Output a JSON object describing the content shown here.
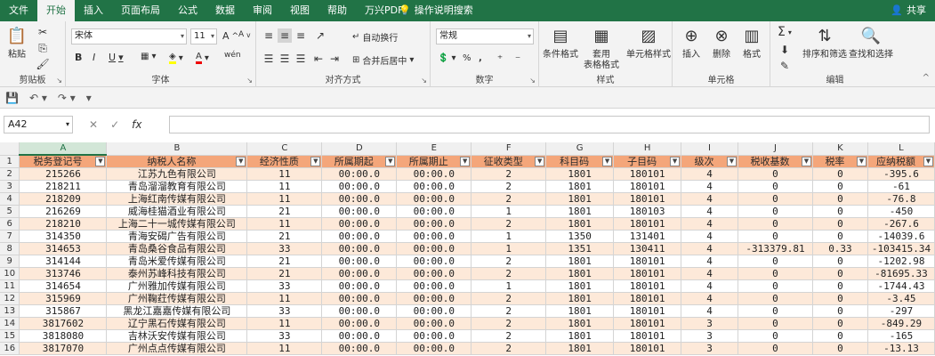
{
  "menu": {
    "tabs": [
      "文件",
      "开始",
      "插入",
      "页面布局",
      "公式",
      "数据",
      "审阅",
      "视图",
      "帮助",
      "万兴PDF"
    ],
    "active": "开始",
    "tellme": "操作说明搜索",
    "share": "共享"
  },
  "ribbon": {
    "clipboard": {
      "paste": "粘贴",
      "label": "剪贴板"
    },
    "font": {
      "name": "宋体",
      "size": "11",
      "bold": "B",
      "italic": "I",
      "underline": "U",
      "grow": "A",
      "shrink": "A",
      "fill_letter": "",
      "color_letter": "A",
      "wen": "wén",
      "label": "字体"
    },
    "align": {
      "wrap": "自动换行",
      "merge": "合并后居中",
      "label": "对齐方式"
    },
    "number": {
      "format": "常规",
      "percent": "%",
      "comma": ",",
      "label": "数字"
    },
    "styles": {
      "cond": "条件格式",
      "table1": "套用",
      "table2": "表格格式",
      "cell": "单元格样式",
      "label": "样式"
    },
    "cells": {
      "insert": "插入",
      "delete": "删除",
      "format": "格式",
      "label": "单元格"
    },
    "editing": {
      "sum": "Σ",
      "sort": "排序和筛选",
      "find": "查找和选择",
      "label": "编辑"
    }
  },
  "formula_bar": {
    "namebox": "A42",
    "fx": "fx",
    "value": ""
  },
  "sheet": {
    "columns": [
      "A",
      "B",
      "C",
      "D",
      "E",
      "F",
      "G",
      "H",
      "I",
      "J",
      "K",
      "L"
    ],
    "selected_column": "A",
    "selected_cell": "A42",
    "headers": [
      "税务登记号",
      "纳税人名称",
      "经济性质",
      "所属期起",
      "所属期止",
      "征收类型",
      "科目码",
      "子目码",
      "级次",
      "税收基数",
      "税率",
      "应纳税额"
    ],
    "rows": [
      {
        "n": "2",
        "c": [
          "215266",
          "江苏九色有限公司",
          "11",
          "00:00.0",
          "00:00.0",
          "2",
          "1801",
          "180101",
          "4",
          "0",
          "0",
          "-395.6"
        ]
      },
      {
        "n": "3",
        "c": [
          "218211",
          "青岛溜溜教育有限公司",
          "11",
          "00:00.0",
          "00:00.0",
          "2",
          "1801",
          "180101",
          "4",
          "0",
          "0",
          "-61"
        ]
      },
      {
        "n": "4",
        "c": [
          "218209",
          "上海红南传媒有限公司",
          "11",
          "00:00.0",
          "00:00.0",
          "2",
          "1801",
          "180101",
          "4",
          "0",
          "0",
          "-76.8"
        ]
      },
      {
        "n": "5",
        "c": [
          "216269",
          "威海桂猫酒业有限公司",
          "21",
          "00:00.0",
          "00:00.0",
          "1",
          "1801",
          "180103",
          "4",
          "0",
          "0",
          "-450"
        ]
      },
      {
        "n": "6",
        "c": [
          "218210",
          "上海二十一城传媒有限公司",
          "11",
          "00:00.0",
          "00:00.0",
          "2",
          "1801",
          "180101",
          "4",
          "0",
          "0",
          "-267.6"
        ]
      },
      {
        "n": "7",
        "c": [
          "314350",
          "青海安碣广告有限公司",
          "21",
          "00:00.0",
          "00:00.0",
          "1",
          "1350",
          "131401",
          "4",
          "0",
          "0",
          "-14039.6"
        ]
      },
      {
        "n": "8",
        "c": [
          "314653",
          "青岛桑谷食品有限公司",
          "33",
          "00:00.0",
          "00:00.0",
          "1",
          "1351",
          "130411",
          "4",
          "-313379.81",
          "0.33",
          "-103415.34"
        ]
      },
      {
        "n": "9",
        "c": [
          "314144",
          "青岛米爱传媒有限公司",
          "21",
          "00:00.0",
          "00:00.0",
          "2",
          "1801",
          "180101",
          "4",
          "0",
          "0",
          "-1202.98"
        ]
      },
      {
        "n": "10",
        "c": [
          "313746",
          "泰州苏峰科技有限公司",
          "21",
          "00:00.0",
          "00:00.0",
          "2",
          "1801",
          "180101",
          "4",
          "0",
          "0",
          "-81695.33"
        ]
      },
      {
        "n": "11",
        "c": [
          "314654",
          "广州雅加传媒有限公司",
          "33",
          "00:00.0",
          "00:00.0",
          "1",
          "1801",
          "180101",
          "4",
          "0",
          "0",
          "-1744.43"
        ]
      },
      {
        "n": "12",
        "c": [
          "315969",
          "广州鞠荭传媒有限公司",
          "11",
          "00:00.0",
          "00:00.0",
          "2",
          "1801",
          "180101",
          "4",
          "0",
          "0",
          "-3.45"
        ]
      },
      {
        "n": "13",
        "c": [
          "315867",
          "黑龙江嘉嘉传媒有限公司",
          "33",
          "00:00.0",
          "00:00.0",
          "2",
          "1801",
          "180101",
          "4",
          "0",
          "0",
          "-297"
        ]
      },
      {
        "n": "14",
        "c": [
          "3817602",
          "辽宁黑石传媒有限公司",
          "11",
          "00:00.0",
          "00:00.0",
          "2",
          "1801",
          "180101",
          "3",
          "0",
          "0",
          "-849.29"
        ]
      },
      {
        "n": "15",
        "c": [
          "3818080",
          "吉林沃安传媒有限公司",
          "33",
          "00:00.0",
          "00:00.0",
          "2",
          "1801",
          "180101",
          "3",
          "0",
          "0",
          "-165"
        ]
      },
      {
        "n": "16",
        "c": [
          "3817070",
          "广州点点传媒有限公司",
          "11",
          "00:00.0",
          "00:00.0",
          "2",
          "1801",
          "180101",
          "3",
          "0",
          "0",
          "-13.13"
        ]
      }
    ]
  }
}
